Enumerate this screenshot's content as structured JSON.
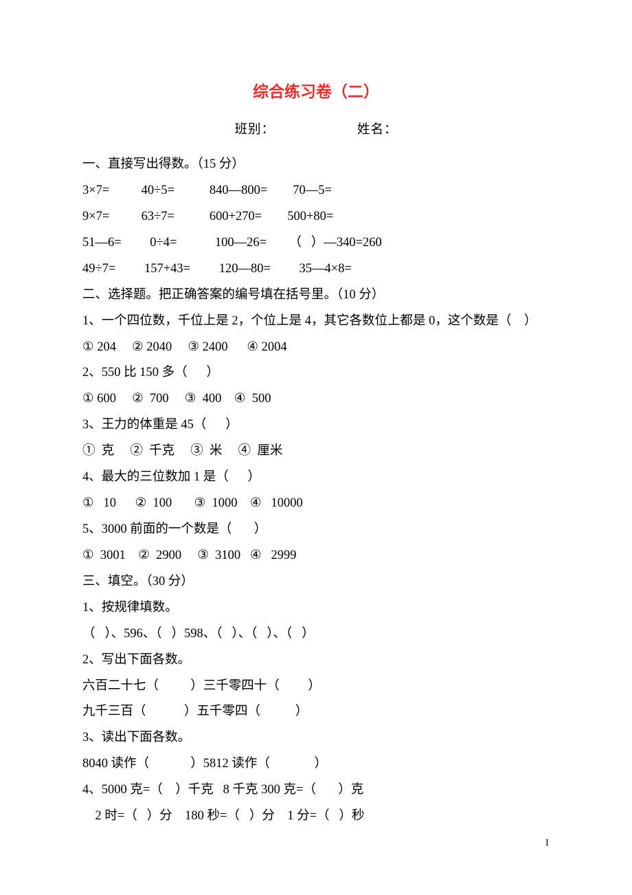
{
  "title": "综合练习卷（二）",
  "nameline_class_label": "班别：",
  "nameline_name_label": "姓名：",
  "section1_heading": "一、直接写出得数。（15 分）",
  "s1r1": "3×7=          40÷5=           840—800=        70—5=",
  "s1r2": "9×7=          63÷7=           600+270=        500+80=",
  "s1r3": "51—6=         0÷4=            100—26=       （   ）—340=260",
  "s1r4": "49÷7=         157+43=         120—80=         35—4×8=",
  "section2_heading": "二、选择题。把正确答案的编号填在括号里。（10 分）",
  "s2q1": "1、一个四位数，千位上是 2，个位上是 4，其它各数位上都是 0，这个数是（    ）",
  "s2q1_opts": "① 204     ② 2040     ③ 2400      ④ 2004",
  "s2q2": "2、550 比 150 多（      ）",
  "s2q2_opts": "① 600     ②  700     ③  400    ④  500",
  "s2q3": "3、王力的体重是 45（      ）",
  "s2q3_opts": "①  克     ②  千克     ③  米     ④  厘米",
  "s2q4": "4、最大的三位数加 1 是（      ）",
  "s2q4_opts": "①   10      ②  100       ③  1000    ④   10000",
  "s2q5": "5、3000 前面的一个数是（       ）",
  "s2q5_opts": "①  3001    ②  2900     ③  3100   ④   2999",
  "section3_heading": "三、填空。（30 分）",
  "s3q1": "1、按规律填数。",
  "s3q1_line": "（   ）、596、（   ）598、（   ）、（   ）、（   ）",
  "s3q2": "2、写出下面各数。",
  "s3q2_l1": "六百二十七（          ）三千零四十（         ）",
  "s3q2_l2": "九千三百（            ）五千零四（           ）",
  "s3q3": "3、读出下面各数。",
  "s3q3_l1": "8040 读作（             ）5812 读作（              ）",
  "s3q4": "4、5000 克=（    ）千克   8 千克 300 克=（       ）克",
  "s3q4_l2": "    2 时=（   ）分    180 秒=（   ）分    1 分=（   ）秒",
  "page_number": "1"
}
